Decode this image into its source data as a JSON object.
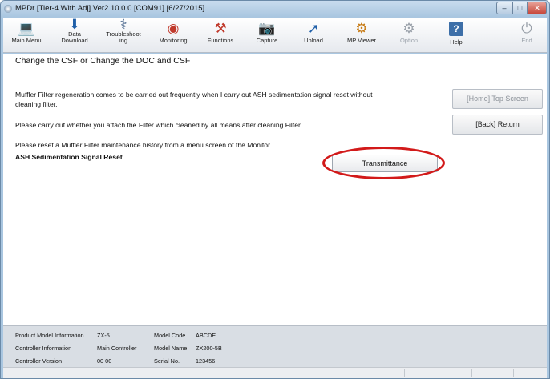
{
  "window": {
    "title": "MPDr [Tier-4 With Adj] Ver2.10.0.0 [COM91] [6/27/2015]",
    "controls": {
      "minimize": "–",
      "maximize": "□",
      "close": "✕"
    }
  },
  "toolbar": {
    "items": [
      {
        "label": "Main Menu",
        "icon": "laptop-icon",
        "glyph": "💻"
      },
      {
        "label": "Data",
        "label2": "Download",
        "icon": "download-arrow-icon",
        "glyph": "⬇"
      },
      {
        "label": "Troubleshoot",
        "label2": "ing",
        "icon": "stethoscope-icon",
        "glyph": "⚕"
      },
      {
        "label": "Monitoring",
        "icon": "gauge-icon",
        "glyph": "◉"
      },
      {
        "label": "Functions",
        "icon": "tools-icon",
        "glyph": "⚒"
      },
      {
        "label": "Capture",
        "icon": "camera-icon",
        "glyph": "📷"
      },
      {
        "label": "Upload",
        "icon": "upload-arrow-icon",
        "glyph": "➚"
      },
      {
        "label": "MP Viewer",
        "icon": "viewer-icon",
        "glyph": "⚙"
      },
      {
        "label": "Option",
        "icon": "option-icon",
        "glyph": "⚙"
      },
      {
        "label": "Help",
        "icon": "help-icon",
        "glyph": "?"
      },
      {
        "label": "End",
        "icon": "power-icon",
        "glyph": "⏻"
      }
    ]
  },
  "main": {
    "title": "Change the CSF or Change the DOC and CSF",
    "messages": [
      "Muffler Filter regeneration comes to be carried out frequently when I carry out ASH sedimentation signal reset without",
      "cleaning filter.",
      "Please carry out whether you attach the Filter which cleaned by all means after cleaning Filter.",
      "Please reset a Muffler Filter maintenance history from a menu screen of the Monitor .",
      "ASH Sedimentation Signal Reset"
    ],
    "transmit_label": "Transmittance",
    "top_screen_label": "[Home] Top Screen",
    "return_label": "[Back] Return"
  },
  "footer": {
    "product_model_label": "Product Model Information",
    "product_model_value": "ZX-5",
    "controller_info_label": "Controller Information",
    "controller_info_value": "Main Controller",
    "controller_version_label": "Controller Version",
    "controller_version_value": "00 00",
    "model_code_label": "Model Code",
    "model_code_value": "ABCDE",
    "model_name_label": "Model Name",
    "model_name_value": "ZX200-5B",
    "serial_label": "Serial No.",
    "serial_value": "123456"
  },
  "colors": {
    "highlight_ring": "#d21a1a",
    "title_bar": "#a9c6e0"
  }
}
